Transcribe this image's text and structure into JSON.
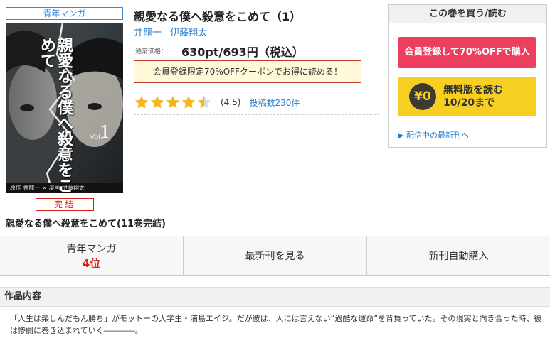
{
  "sidebar": {
    "genre_tag": "青年マンガ",
    "status_tag": "完結",
    "series_title": "親愛なる僕へ殺意をこめて(11巻完結)",
    "cover": {
      "title_text": "親愛なる僕へ殺意をこめて",
      "vol_label": "Vol.",
      "vol_number": "1",
      "author_credit": "原作 井龍一 × 漫画 伊藤翔太"
    }
  },
  "product": {
    "title": "親愛なる僕へ殺意をこめて（1）",
    "authors": [
      "井龍一",
      "伊藤翔太"
    ],
    "price_label": "通常価格：",
    "price": "630pt/693円（税込）",
    "coupon": "会員登録限定70%OFFクーポンでお得に読める！",
    "rating": {
      "stars": 4.5,
      "value_text": "(4.5)",
      "reviews_text": "投稿数230件"
    }
  },
  "buy_box": {
    "heading": "この巻を買う/読む",
    "member_button": "会員登録して70%OFFで購入",
    "free_badge": "¥0",
    "free_line1": "無料版を読む",
    "free_line2": "10/20まで",
    "latest_link": "▶ 配信中の最新刊へ"
  },
  "actions": {
    "ranking_label": "青年マンガ",
    "ranking_value": "4位",
    "latest_label": "最新刊を見る",
    "auto_buy_label": "新刊自動購入"
  },
  "description": {
    "heading": "作品内容",
    "text": "「人生は楽しんだもん勝ち」がモットーの大学生・浦島エイジ。だが彼は、人には言えない“過酷な運命”を背負っていた。その現実と向き合った時、彼は惨劇に巻き込まれていく――――。"
  },
  "colors": {
    "link": "#2a7bc9",
    "accent_red": "#d8201b",
    "member_button": "#ee3e5e",
    "free_button": "#f6cf22",
    "star": "#f2b61f"
  },
  "icons": {
    "star": "star-icon",
    "yen": "yen-icon"
  }
}
